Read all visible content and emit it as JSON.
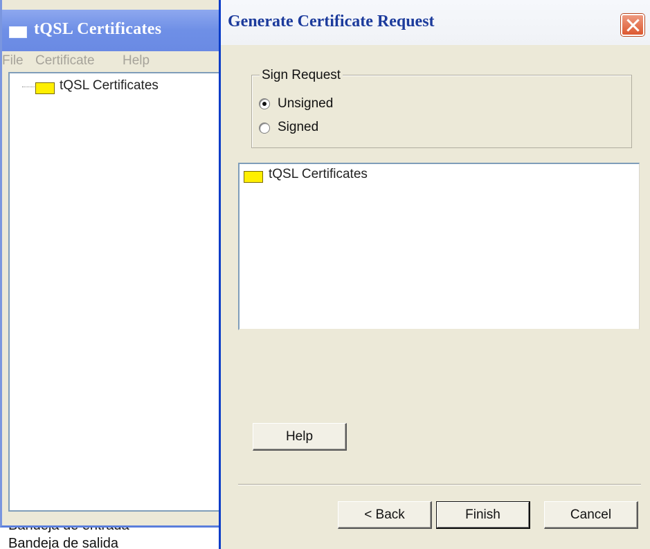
{
  "background": {
    "lines": [
      "Bandeja de entrada",
      "Bandeja de salida"
    ]
  },
  "main_window": {
    "title": "tQSL Certificates",
    "menu": {
      "file": "File",
      "certificate": "Certificate",
      "help": "Help"
    },
    "tree": {
      "root_label": "tQSL Certificates",
      "root_icon": "folder-icon"
    }
  },
  "dialog": {
    "title": "Generate Certificate Request",
    "close_icon": "close-icon",
    "sign_request": {
      "legend": "Sign Request",
      "options": [
        {
          "label": "Unsigned",
          "selected": true
        },
        {
          "label": "Signed",
          "selected": false
        }
      ]
    },
    "tree": {
      "root_label": "tQSL Certificates",
      "root_icon": "folder-icon"
    },
    "buttons": {
      "help": "Help",
      "back": "< Back",
      "finish": "Finish",
      "cancel": "Cancel"
    }
  },
  "colors": {
    "title_bar_blue": "#7a96e8",
    "dialog_title_text": "#1c3b9c",
    "close_button": "#dc5830",
    "folder_yellow": "#ffef00",
    "window_face": "#ece9d8"
  }
}
